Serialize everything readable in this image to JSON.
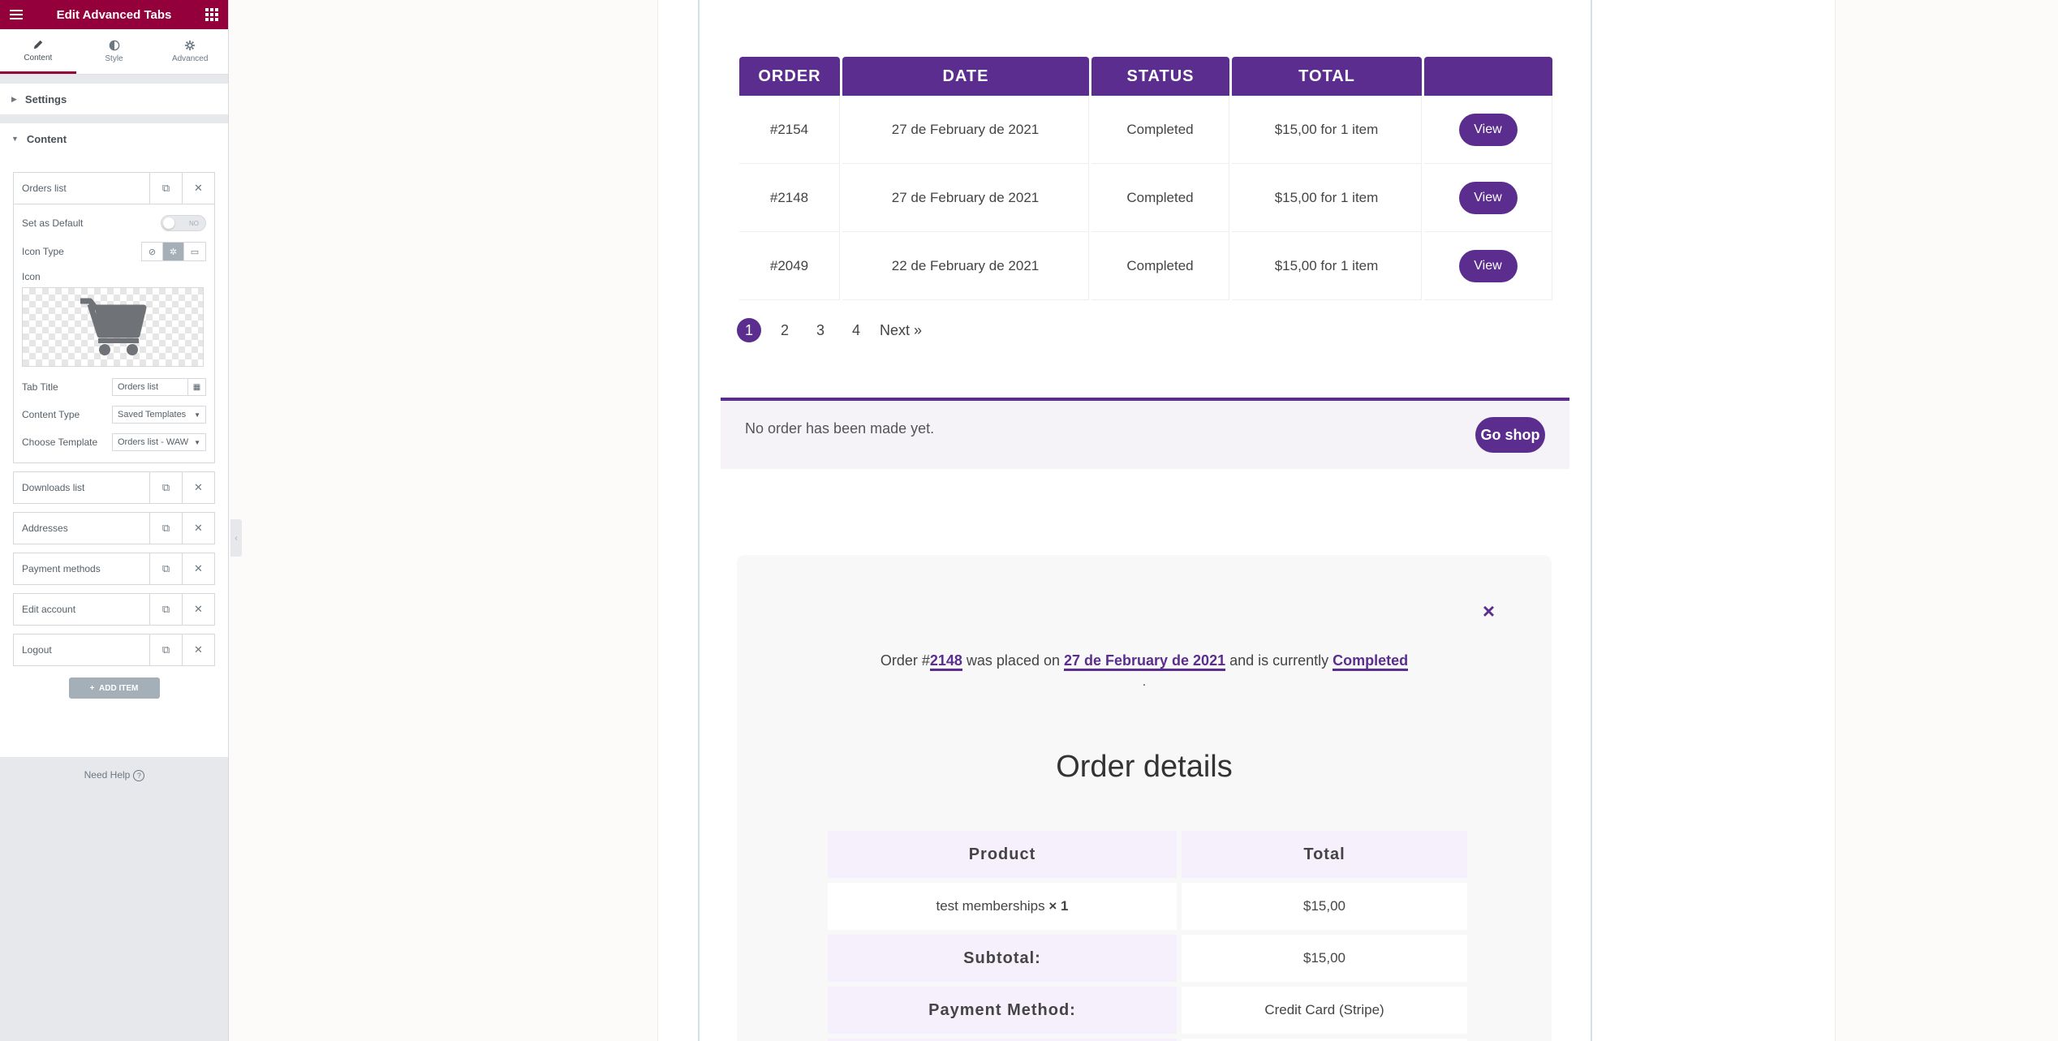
{
  "panel": {
    "title": "Edit Advanced Tabs",
    "tabs": [
      {
        "label": "Content"
      },
      {
        "label": "Style"
      },
      {
        "label": "Advanced"
      }
    ],
    "sections": {
      "settings": "Settings",
      "content": "Content"
    },
    "open_item": {
      "label": "Orders list",
      "set_default_label": "Set as Default",
      "toggle_text": "NO",
      "icon_type_label": "Icon Type",
      "icon_label": "Icon",
      "tab_title_label": "Tab Title",
      "tab_title_value": "Orders list",
      "content_type_label": "Content Type",
      "content_type_value": "Saved Templates",
      "choose_template_label": "Choose Template",
      "choose_template_value": "Orders list - WAW"
    },
    "items": [
      {
        "label": "Downloads list"
      },
      {
        "label": "Addresses"
      },
      {
        "label": "Payment methods"
      },
      {
        "label": "Edit account"
      },
      {
        "label": "Logout"
      }
    ],
    "add_item_label": "ADD ITEM",
    "need_help_label": "Need Help"
  },
  "orders": {
    "headers": [
      "ORDER",
      "DATE",
      "STATUS",
      "TOTAL",
      ""
    ],
    "rows": [
      {
        "order": "#2154",
        "date": "27 de February de 2021",
        "status": "Completed",
        "total": "$15,00 for 1 item",
        "action": "View"
      },
      {
        "order": "#2148",
        "date": "27 de February de 2021",
        "status": "Completed",
        "total": "$15,00 for 1 item",
        "action": "View"
      },
      {
        "order": "#2049",
        "date": "22 de February de 2021",
        "status": "Completed",
        "total": "$15,00 for 1 item",
        "action": "View"
      }
    ],
    "pagination": {
      "pages": [
        "1",
        "2",
        "3",
        "4"
      ],
      "current": "1",
      "next": "Next »"
    }
  },
  "notice": {
    "message": "No order has been made yet.",
    "button": "Go shop"
  },
  "order_modal": {
    "close": "×",
    "line_prefix": "Order #",
    "order_number": "2148",
    "line_mid1": " was placed on ",
    "order_date": "27 de February de 2021",
    "line_mid2": " and is currently ",
    "order_status": "Completed",
    "line_suffix": ".",
    "details_title": "Order details",
    "table_headers": [
      "Product",
      "Total"
    ],
    "product_name": "test memberships",
    "product_qty": "× 1",
    "product_total": "$15,00",
    "subtotal_label": "Subtotal:",
    "subtotal_value": "$15,00",
    "payment_label": "Payment Method:",
    "payment_value": "Credit Card (Stripe)"
  },
  "colors": {
    "panel_header": "#93003c",
    "accent": "#5b2d8e",
    "panel_bg": "#e6e8eb"
  }
}
